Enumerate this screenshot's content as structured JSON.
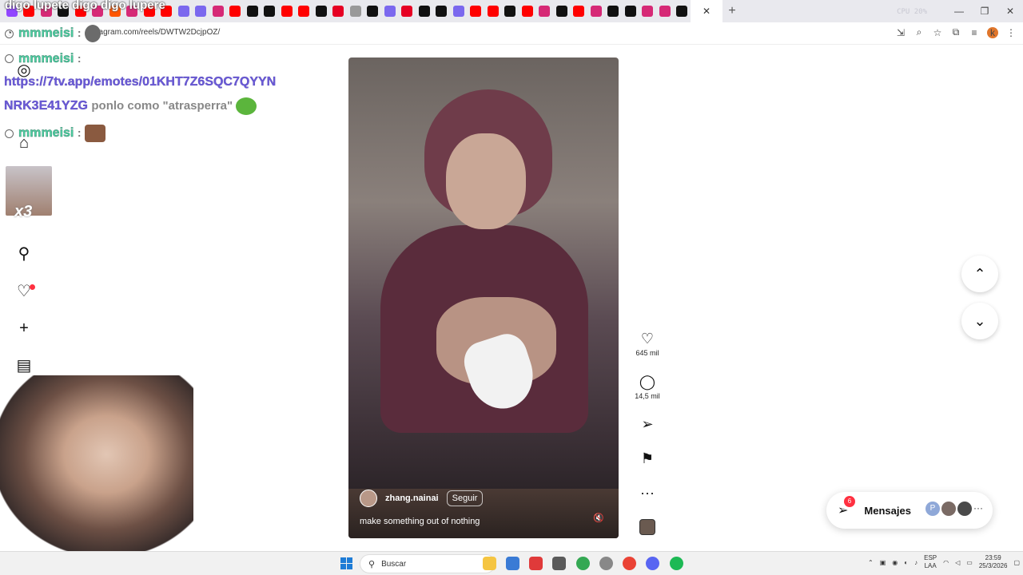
{
  "browser": {
    "url": "instagram.com/reels/DWTW2DcjpOZ/",
    "tab_close": "✕",
    "new_tab": "+",
    "tab_favicons": [
      {
        "icon": "twitch-icon",
        "color": "#9146ff"
      },
      {
        "icon": "youtube-icon",
        "color": "#ff0000"
      },
      {
        "icon": "instagram-icon",
        "color": "#d62976"
      },
      {
        "icon": "tiktok-icon",
        "color": "#111111"
      },
      {
        "icon": "youtube-icon",
        "color": "#ff0000"
      },
      {
        "icon": "instagram-icon",
        "color": "#d62976"
      },
      {
        "icon": "soundcloud-icon",
        "color": "#ff5500"
      },
      {
        "icon": "instagram-icon",
        "color": "#d62976"
      },
      {
        "icon": "youtube-icon",
        "color": "#ff0000"
      },
      {
        "icon": "youtube-icon",
        "color": "#ff0000"
      },
      {
        "icon": "edit-icon",
        "color": "#7b68ee"
      },
      {
        "icon": "edit-icon",
        "color": "#7b68ee"
      },
      {
        "icon": "instagram-icon",
        "color": "#d62976"
      },
      {
        "icon": "youtube-icon",
        "color": "#ff0000"
      },
      {
        "icon": "tiktok-icon",
        "color": "#111111"
      },
      {
        "icon": "tiktok-icon",
        "color": "#111111"
      },
      {
        "icon": "youtube-icon",
        "color": "#ff0000"
      },
      {
        "icon": "youtube-icon",
        "color": "#ff0000"
      },
      {
        "icon": "tiktok-icon",
        "color": "#111111"
      },
      {
        "icon": "pinterest-icon",
        "color": "#e60023"
      },
      {
        "icon": "generic-icon",
        "color": "#999999"
      },
      {
        "icon": "tiktok-icon",
        "color": "#111111"
      },
      {
        "icon": "edit-icon",
        "color": "#7b68ee"
      },
      {
        "icon": "pinterest-icon",
        "color": "#e60023"
      },
      {
        "icon": "tiktok-icon",
        "color": "#111111"
      },
      {
        "icon": "tiktok-icon",
        "color": "#111111"
      },
      {
        "icon": "edit-icon",
        "color": "#7b68ee"
      },
      {
        "icon": "youtube-icon",
        "color": "#ff0000"
      },
      {
        "icon": "youtube-icon",
        "color": "#ff0000"
      },
      {
        "icon": "tiktok-icon",
        "color": "#111111"
      },
      {
        "icon": "youtube-icon",
        "color": "#ff0000"
      },
      {
        "icon": "instagram-icon",
        "color": "#d62976"
      },
      {
        "icon": "tiktok-icon",
        "color": "#111111"
      },
      {
        "icon": "youtube-icon",
        "color": "#ff0000"
      },
      {
        "icon": "instagram-icon",
        "color": "#d62976"
      },
      {
        "icon": "tiktok-icon",
        "color": "#111111"
      },
      {
        "icon": "tiktok-icon",
        "color": "#111111"
      },
      {
        "icon": "instagram-icon",
        "color": "#d62976"
      },
      {
        "icon": "instagram-icon",
        "color": "#d62976"
      },
      {
        "icon": "tiktok-icon",
        "color": "#111111"
      }
    ],
    "sys_overlay": "CPU 20%",
    "window": {
      "minimize": "—",
      "restore": "❐",
      "close": "✕"
    }
  },
  "chat": {
    "top_line": "digo lupete digo digo lupere",
    "messages": [
      {
        "user": "mmmeisi",
        "sep": ":",
        "link": "",
        "text": ""
      },
      {
        "user": "mmmeisi",
        "sep": ":",
        "link": "",
        "text": ""
      },
      {
        "user": "",
        "sep": "",
        "link": "https://7tv.app/emotes/01KHT7Z6SQC7QYYN",
        "text": ""
      },
      {
        "user": "",
        "sep": "",
        "link": "NRK3E41YZG",
        "text": "ponlo como \"atrasperra\""
      },
      {
        "user": "mmmeisi",
        "sep": ":",
        "link": "",
        "text": ""
      }
    ],
    "x3": "x3"
  },
  "reel": {
    "author": "zhang.nainai",
    "follow_label": "Seguir",
    "caption": "make something out of nothing",
    "likes": "645 mil",
    "comments": "14,5 mil",
    "more": "···"
  },
  "messages_pill": {
    "label": "Mensajes",
    "badge": "6",
    "avatar_letter": "P"
  },
  "taskbar": {
    "search_placeholder": "Buscar",
    "lang_top": "ESP",
    "lang_bottom": "LAA",
    "time": "23:59",
    "date": "25/3/2026"
  }
}
